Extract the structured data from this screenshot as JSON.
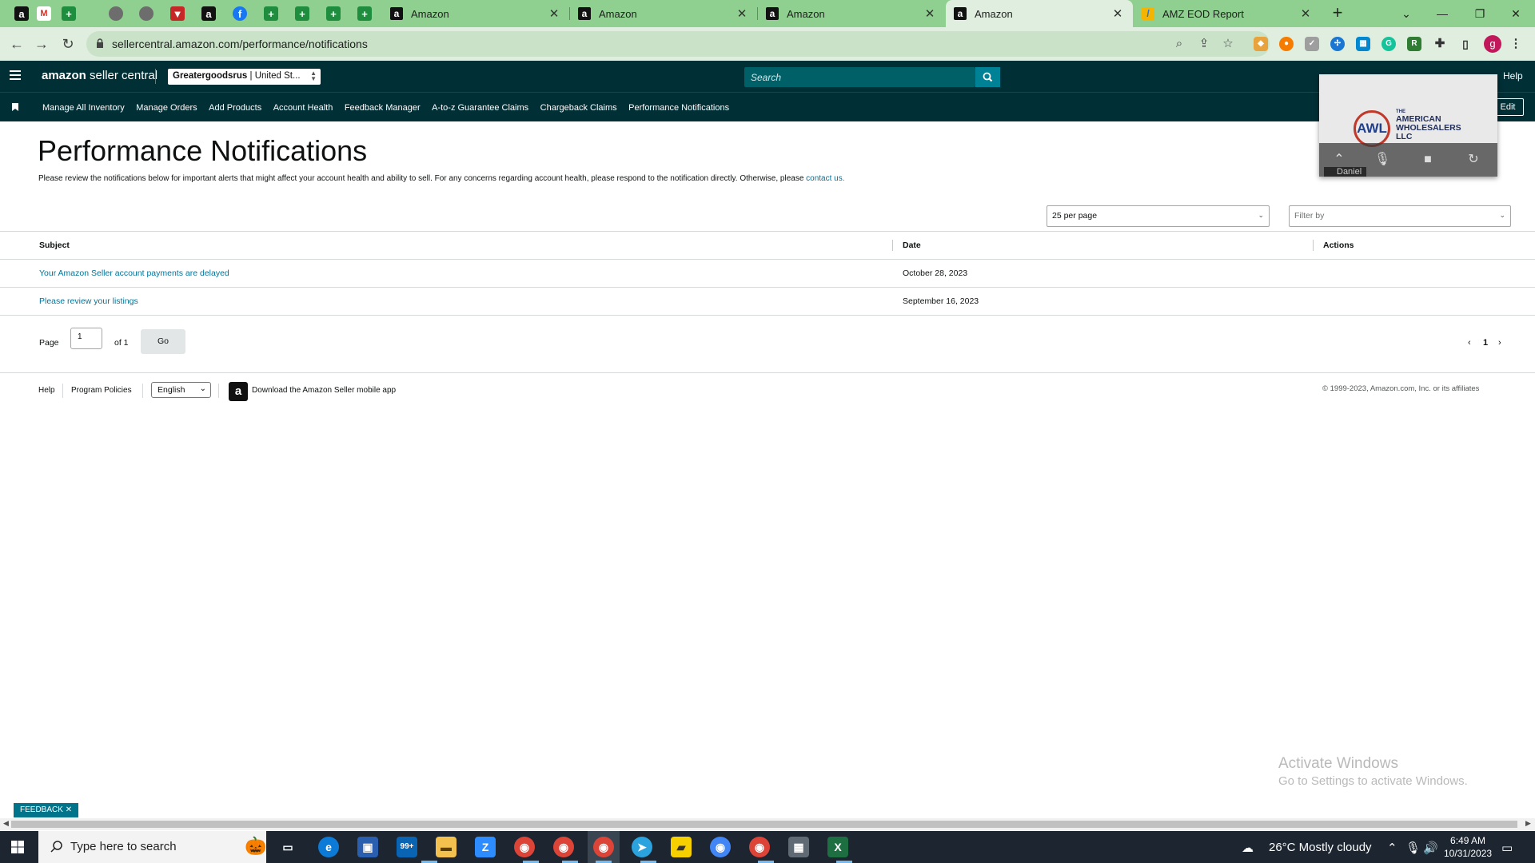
{
  "browser": {
    "tabs": [
      {
        "title": "Amazon",
        "active": false
      },
      {
        "title": "Amazon",
        "active": false
      },
      {
        "title": "Amazon",
        "active": false
      },
      {
        "title": "Amazon",
        "active": true
      },
      {
        "title": "AMZ EOD Report",
        "active": false
      }
    ],
    "url": "sellercentral.amazon.com/performance/notifications",
    "profile_initial": "g"
  },
  "header": {
    "logo_bold": "amazon",
    "logo_rest": " seller central",
    "account_store": "Greatergoodsrus",
    "account_region": " | United St...",
    "search_placeholder": "Search",
    "help": "Help",
    "nav": [
      "Manage All Inventory",
      "Manage Orders",
      "Add Products",
      "Account Health",
      "Feedback Manager",
      "A-to-z Guarantee Claims",
      "Chargeback Claims",
      "Performance Notifications"
    ],
    "edit": "Edit"
  },
  "meeting": {
    "logo_text": "AWL",
    "company_line1": "THE",
    "company_line2": "AMERICAN",
    "company_line3": "WHOLESALERS",
    "company_line4": "LLC",
    "participant": "Daniel"
  },
  "page": {
    "title": "Performance Notifications",
    "description": "Please review the notifications below for important alerts that might affect your account health and ability to sell. For any concerns regarding account health, please respond to the notification directly. Otherwise, please ",
    "contact_link": "contact us.",
    "per_page": "25 per page",
    "filter_placeholder": "Filter by"
  },
  "table": {
    "headers": {
      "subject": "Subject",
      "date": "Date",
      "actions": "Actions"
    },
    "rows": [
      {
        "subject": "Your Amazon Seller account payments are delayed",
        "date": "October 28, 2023"
      },
      {
        "subject": "Please review your listings",
        "date": "September 16, 2023"
      }
    ]
  },
  "pager": {
    "page_label": "Page",
    "page_value": "1",
    "of_label": "of 1",
    "go": "Go",
    "current": "1"
  },
  "footer": {
    "help": "Help",
    "policies": "Program Policies",
    "language": "English",
    "app": "Download the Amazon Seller mobile app",
    "copyright": "© 1999-2023, Amazon.com, Inc. or its affiliates"
  },
  "watermark": {
    "line1": "Activate Windows",
    "line2": "Go to Settings to activate Windows."
  },
  "feedback": "FEEDBACK",
  "taskbar": {
    "search_placeholder": "Type here to search",
    "mail_badge": "99+",
    "weather": "26°C  Mostly cloudy",
    "time": "6:49 AM",
    "date": "10/31/2023"
  },
  "colors": {
    "header_bg": "#002f36",
    "search_bg": "#006068",
    "search_btn": "#008296",
    "link": "#00749a",
    "tab_strip": "#8fcf8f"
  }
}
